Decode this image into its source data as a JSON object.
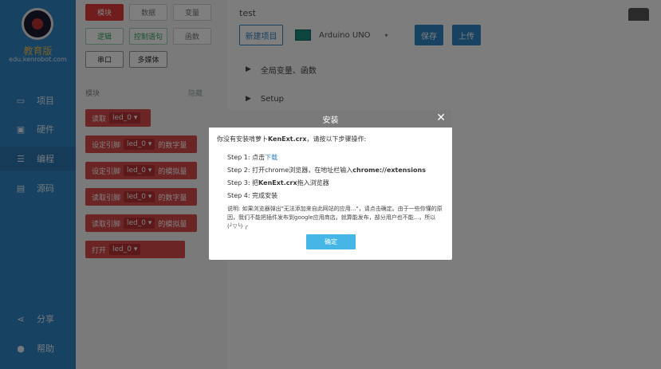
{
  "sidebar": {
    "brand_title": "教育版",
    "brand_sub": "edu.kenrobot.com",
    "items": [
      {
        "label": "项目",
        "icon": "folder-icon"
      },
      {
        "label": "硬件",
        "icon": "chip-icon"
      },
      {
        "label": "编程",
        "icon": "list-icon"
      },
      {
        "label": "源码",
        "icon": "code-icon"
      }
    ],
    "bottom": [
      {
        "label": "分享",
        "icon": "share-icon"
      },
      {
        "label": "帮助",
        "icon": "help-icon"
      }
    ]
  },
  "toolbox": {
    "categories": [
      "模块",
      "数据",
      "变量",
      "逻辑",
      "控制语句",
      "函数",
      "串口",
      "多媒体"
    ],
    "section_label": "模块",
    "section_link": "隐藏",
    "blocks": [
      {
        "prefix": "读取",
        "pill": "led_0",
        "suffix": ""
      },
      {
        "prefix": "设定引脚",
        "pill": "led_0",
        "suffix": "的数字量"
      },
      {
        "prefix": "设定引脚",
        "pill": "led_0",
        "suffix": "的模拟量"
      },
      {
        "prefix": "读取引脚",
        "pill": "led_0",
        "suffix": "的数字量"
      },
      {
        "prefix": "读取引脚",
        "pill": "led_0",
        "suffix": "的模拟量"
      },
      {
        "prefix": "打开",
        "pill": "led_0",
        "suffix": ""
      }
    ]
  },
  "main": {
    "project_title": "test",
    "new_button": "新建项目",
    "board": "Arduino UNO",
    "save_button": "保存",
    "upload_button": "上传",
    "sections": [
      "全局变量、函数",
      "Setup"
    ]
  },
  "modal": {
    "title": "安装",
    "intro_pre": "你没有安装啃萝卜",
    "intro_bold": "KenExt.crx",
    "intro_post": "，请按以下步骤操作:",
    "step1_pre": "Step 1: 点击",
    "step1_link": "下载",
    "step2_pre": "Step 2: 打开chrome浏览器，在地址栏输入",
    "step2_bold": "chrome://extensions",
    "step3_pre": "Step 3: 把",
    "step3_bold": "KenExt.crx",
    "step3_post": "拖入浏览器",
    "step4": "Step 4: 完成安装",
    "note": "说明: 如果浏览器弹出\"无法添加来自此网站的应用...\"，请点击确定。由于一些你懂的原因，我们不能把插件发布到google应用商店。就算能发布，部分用户也不能...，所以 (╯▽╰) ╭",
    "ok_button": "确定",
    "close_glyph": "✕"
  }
}
